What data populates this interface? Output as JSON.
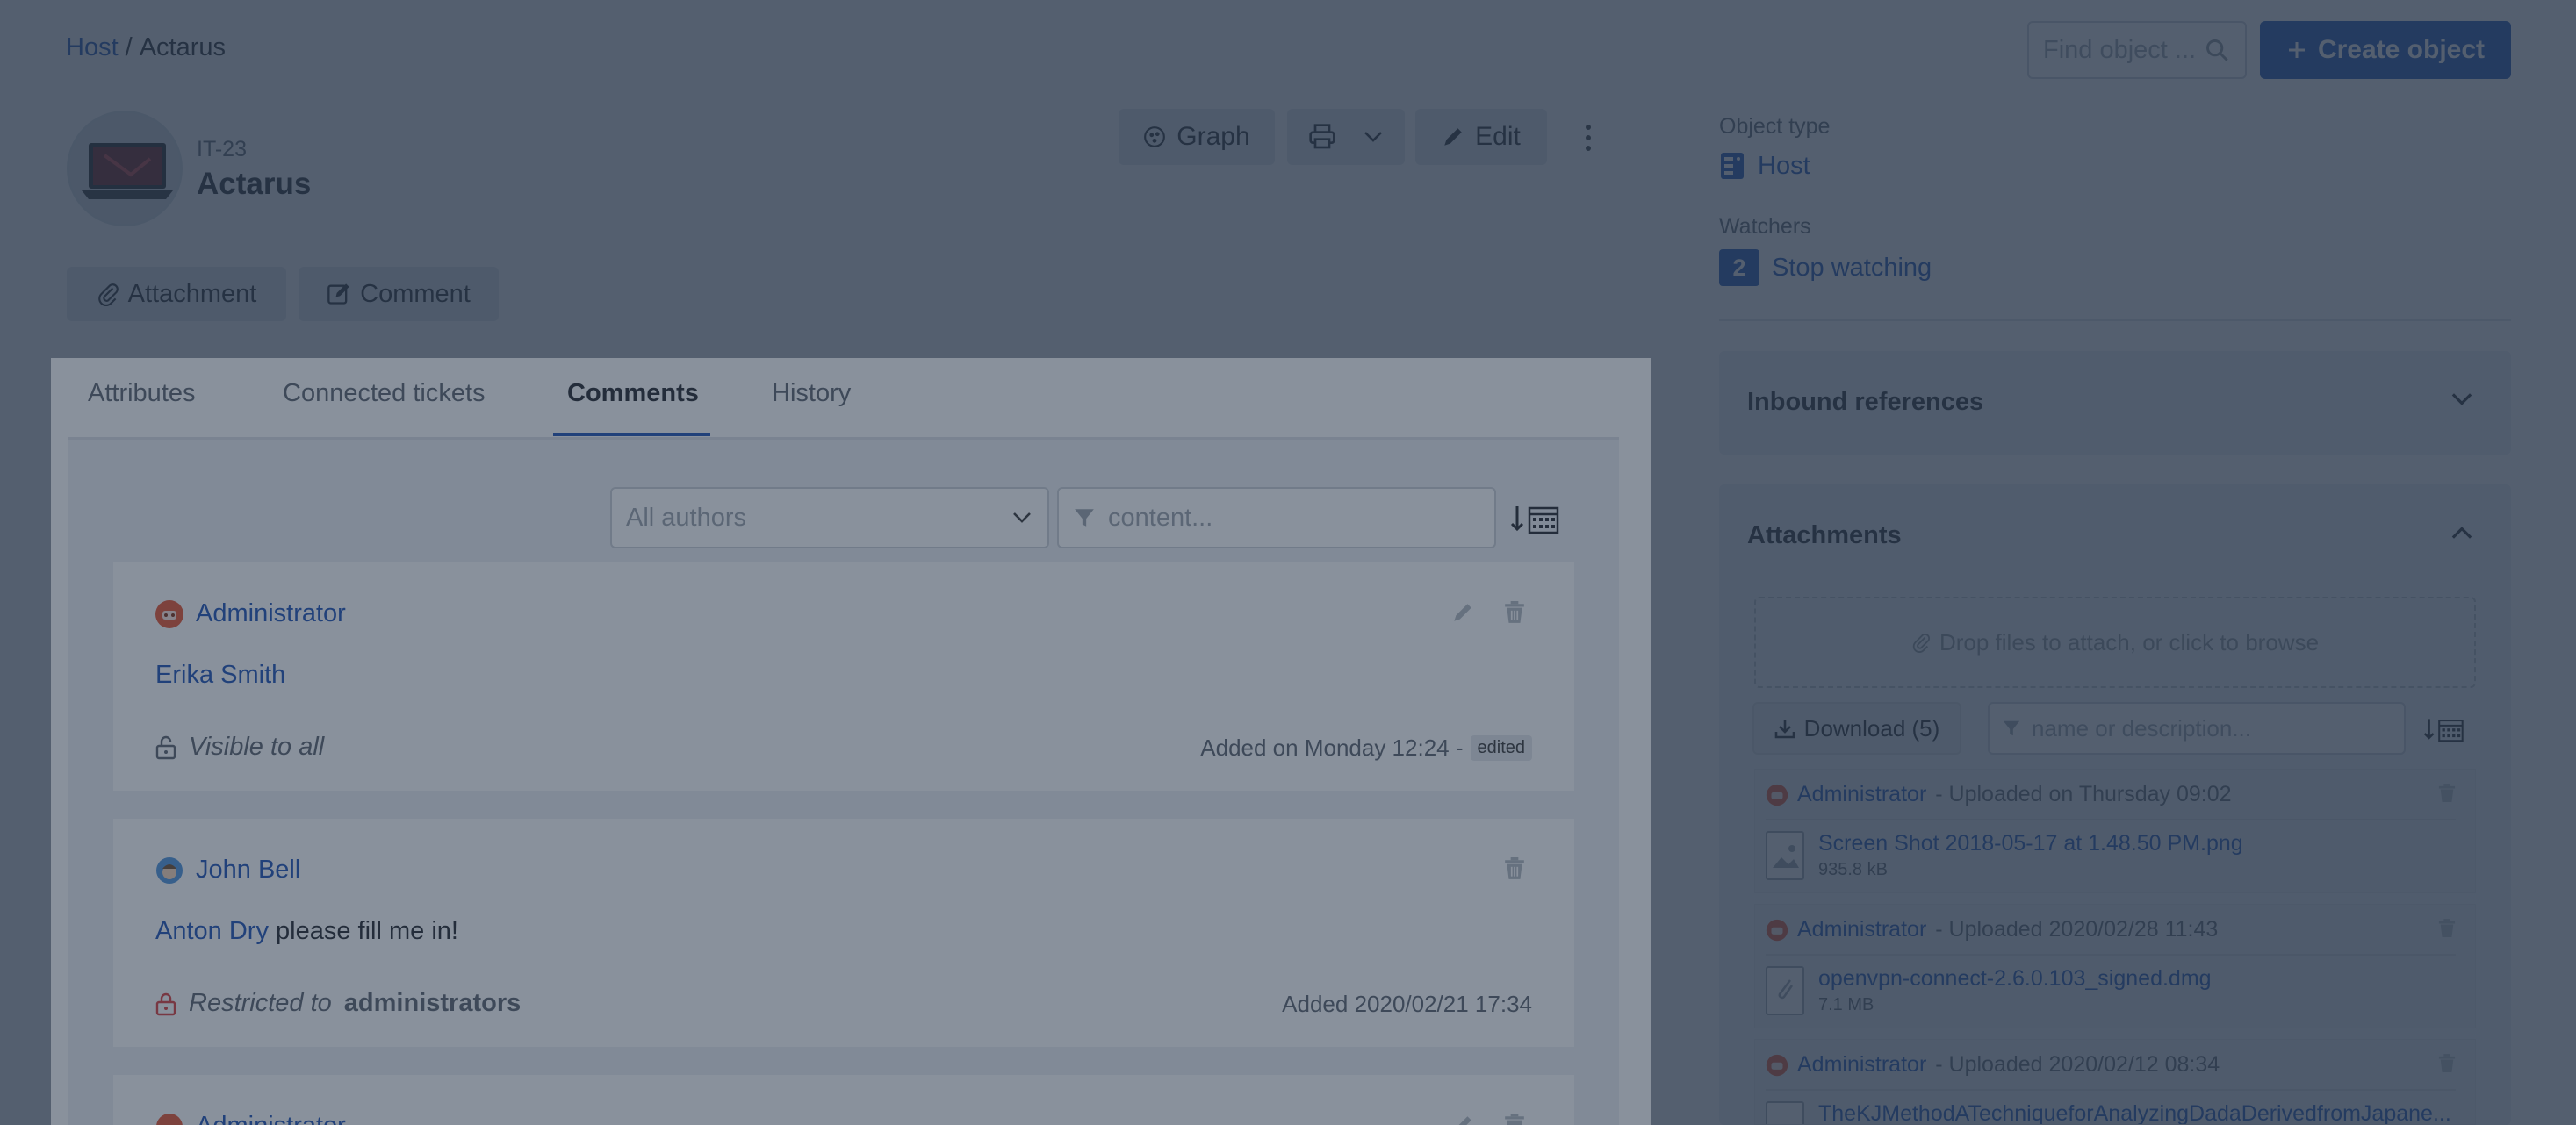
{
  "breadcrumb": {
    "parent": "Host",
    "separator": "/",
    "current": "Actarus"
  },
  "search": {
    "placeholder": "Find object ..."
  },
  "create_button": {
    "label": "Create object"
  },
  "object": {
    "code": "IT-23",
    "title": "Actarus"
  },
  "toolbar": {
    "graph_label": "Graph",
    "edit_label": "Edit"
  },
  "actions": {
    "attachment_label": "Attachment",
    "comment_label": "Comment"
  },
  "tabs": [
    {
      "label": "Attributes"
    },
    {
      "label": "Connected tickets"
    },
    {
      "label": "Comments"
    },
    {
      "label": "History"
    }
  ],
  "filters": {
    "authors_placeholder": "All authors",
    "content_placeholder": "content..."
  },
  "comments": [
    {
      "author": "Administrator",
      "mention": "Erika Smith",
      "text": "",
      "visibility_prefix": "Visible to all",
      "visibility_group": "",
      "date": "Added on Monday 12:24 -",
      "badge": "edited"
    },
    {
      "author": "John Bell",
      "mention": "Anton Dry",
      "text": "please fill me in!",
      "visibility_prefix": "Restricted to",
      "visibility_group": "administrators",
      "date": "Added 2020/02/21 17:34",
      "badge": ""
    },
    {
      "author": "Administrator"
    }
  ],
  "sidebar": {
    "object_type_label": "Object type",
    "object_type_value": "Host",
    "watchers_label": "Watchers",
    "watchers_count": "2",
    "watchers_action": "Stop watching",
    "inbound_title": "Inbound references",
    "attachments_title": "Attachments",
    "dropzone_text": "Drop files to attach, or click to browse",
    "download_label": "Download (5)",
    "attachment_filter_placeholder": "name or description...",
    "attachments": [
      {
        "uploader": "Administrator",
        "uploaded": "- Uploaded on Thursday 09:02",
        "file": "Screen Shot 2018-05-17 at 1.48.50 PM.png",
        "size": "935.8 kB"
      },
      {
        "uploader": "Administrator",
        "uploaded": "- Uploaded 2020/02/28 11:43",
        "file": "openvpn-connect-2.6.0.103_signed.dmg",
        "size": "7.1 MB"
      },
      {
        "uploader": "Administrator",
        "uploaded": "- Uploaded 2020/02/12 08:34",
        "file": "TheKJMethodATechniqueforAnalyzingDadaDerivedfromJapane...",
        "size": ""
      }
    ]
  },
  "colors": {
    "accent": "#1a4fb4",
    "overlay": "#28374b",
    "restricted": "#d93b3b"
  }
}
